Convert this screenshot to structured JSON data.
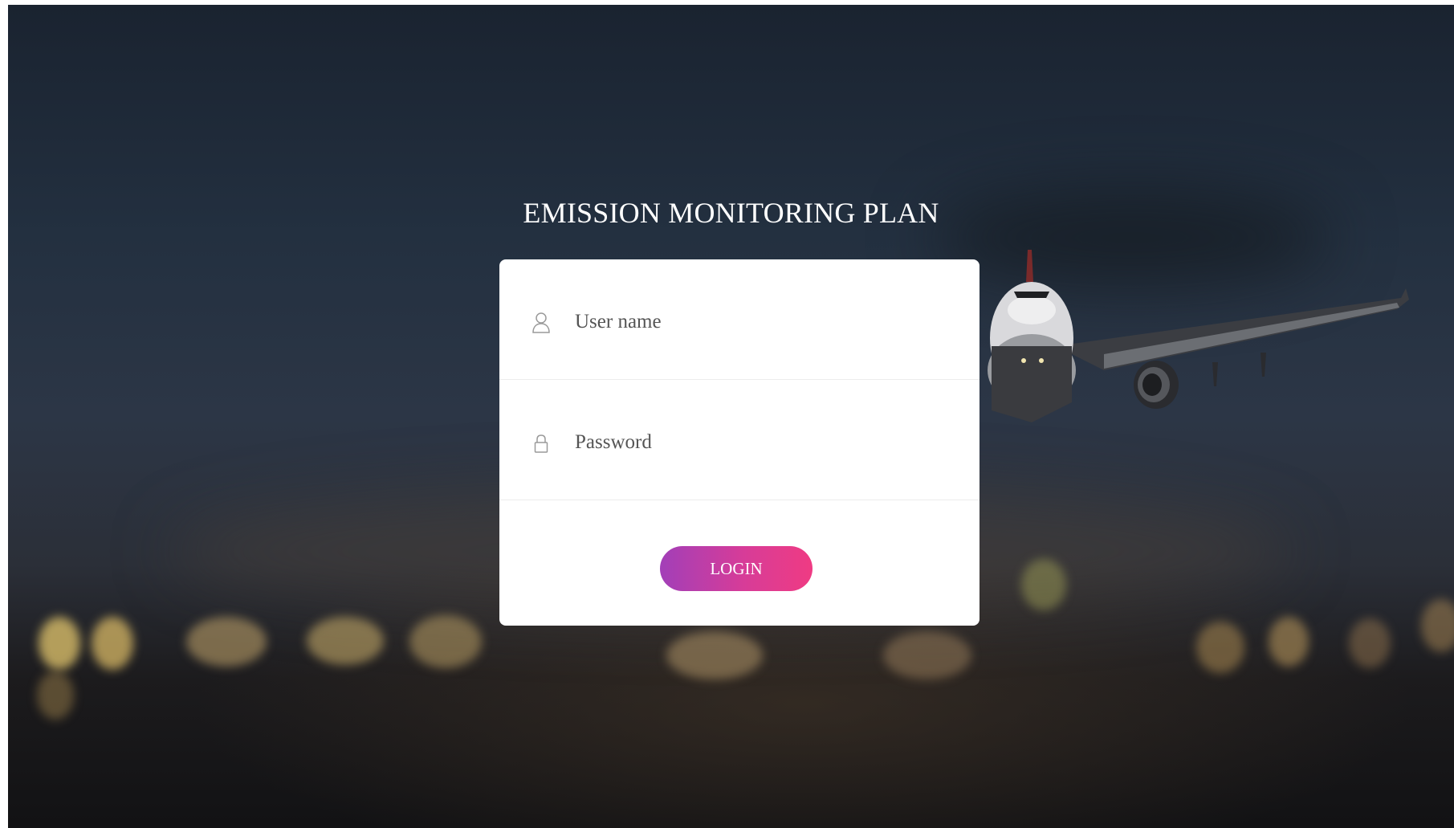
{
  "page": {
    "title": "EMISSION MONITORING PLAN"
  },
  "login_form": {
    "username_placeholder": "User name",
    "password_placeholder": "Password",
    "login_label": "LOGIN",
    "username_icon": "user-icon",
    "password_icon": "lock-icon"
  },
  "colors": {
    "button_gradient_start": "#a23fb8",
    "button_gradient_end": "#ef3b83",
    "card_background": "#ffffff",
    "title_color": "#ffffff"
  }
}
